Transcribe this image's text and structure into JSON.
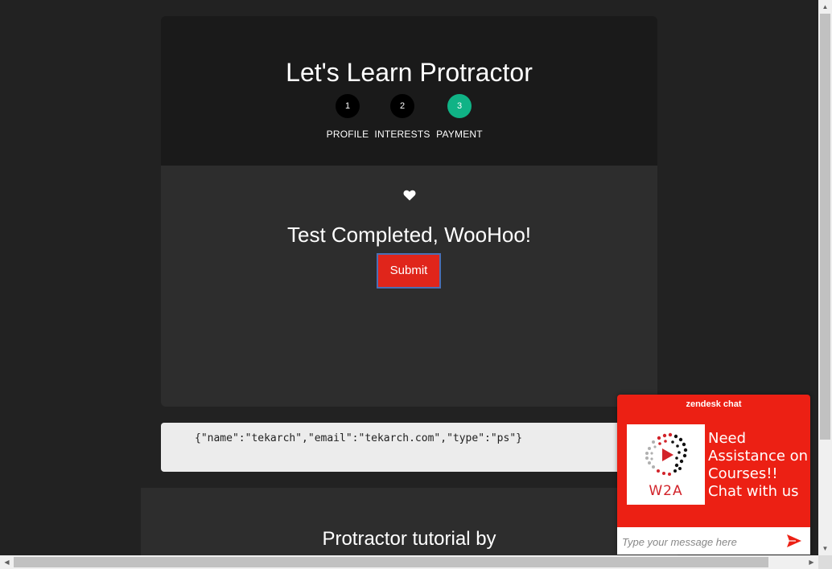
{
  "header": {
    "title": "Let's Learn Protractor"
  },
  "steps": [
    {
      "number": "1",
      "label": "PROFILE",
      "active": false
    },
    {
      "number": "2",
      "label": "INTERESTS",
      "active": false
    },
    {
      "number": "3",
      "label": "PAYMENT",
      "active": true
    }
  ],
  "content": {
    "icon": "heart-icon",
    "message": "Test Completed, WooHoo!",
    "submit_label": "Submit"
  },
  "json_output": "{\"name\":\"tekarch\",\"email\":\"tekarch.com\",\"type\":\"ps\"}",
  "footer": {
    "title": "Protractor tutorial by"
  },
  "chat_widget": {
    "title": "zendesk chat",
    "logo_text": "W2A",
    "message": "Need Assistance on Courses!! Chat with us",
    "input_placeholder": "Type your message here",
    "send_icon": "send-icon"
  },
  "colors": {
    "page_bg": "#222222",
    "card_bg": "#2d2d2d",
    "header_bg": "#1a1a1a",
    "step_active": "#10b386",
    "submit_bg": "#e0251b",
    "chat_red": "#ec2014"
  }
}
